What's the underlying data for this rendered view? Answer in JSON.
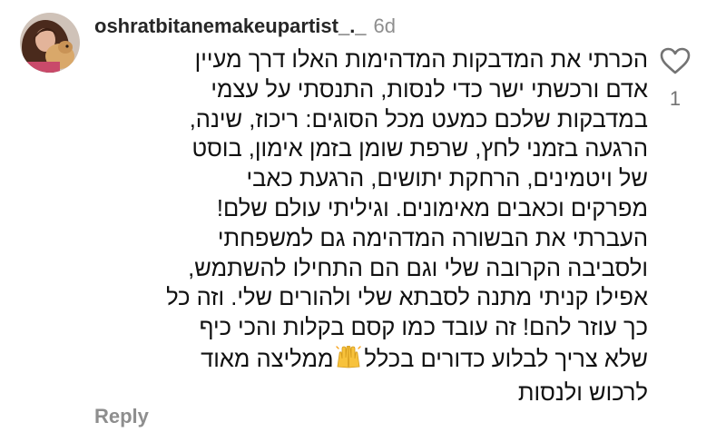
{
  "comment": {
    "username": "oshratbitanemakeupartist_._",
    "time": "6d",
    "lines": [
      "הכרתי את המדבקות המדהימות  האלו דרך מעיין",
      "אדם ורכשתי ישר כדי לנסות, התנסתי על עצמי",
      "במדבקות שלכם כמעט מכל הסוגים: ריכוז, שינה,",
      "הרגעה בזמני לחץ, שרפת שומן בזמן אימון, בוסט",
      "של ויטמינים, הרחקת יתושים, הרגעת כאבי",
      "מפרקים וכאבים מאימונים. וגיליתי עולם שלם!",
      "העברתי את הבשורה המדהימה גם למשפחתי",
      "ולסביבה הקרובה שלי וגם הם התחילו להשתמש,",
      "אפילו קניתי מתנה לסבתא שלי ולהורים שלי. וזה כל",
      "כך עוזר להם! זה עובד כמו קסם בקלות והכי כיף"
    ],
    "line_with_emoji": {
      "before": "שלא צריך לבלוע כדורים בכלל",
      "emoji": "raising-hands-emoji",
      "after": "ממליצה מאוד"
    },
    "last_line": "לרכוש ולנסות",
    "reply_label": "Reply",
    "like_icon": "heart-outline-icon",
    "like_count": "1"
  },
  "colors": {
    "username": "#262626",
    "meta": "#8e8e8e",
    "body_text": "#111111",
    "like_icon": "#737373"
  }
}
